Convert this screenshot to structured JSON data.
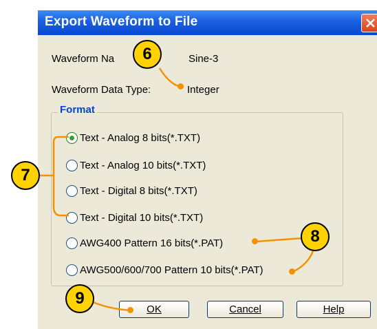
{
  "dialog": {
    "title": "Export Waveform to File",
    "waveform_name_label": "Waveform Na",
    "waveform_name_value": "Sine-3",
    "data_type_label": "Waveform Data Type:",
    "data_type_value": "Integer"
  },
  "format": {
    "legend": "Format",
    "options": [
      {
        "label": "Text - Analog 8 bits(*.TXT)",
        "selected": true
      },
      {
        "label": "Text - Analog 10 bits(*.TXT)",
        "selected": false
      },
      {
        "label": "Text - Digital 8 bits(*.TXT)",
        "selected": false
      },
      {
        "label": "Text - Digital 10 bits(*.TXT)",
        "selected": false
      },
      {
        "label": "AWG400 Pattern 16 bits(*.PAT)",
        "selected": false
      },
      {
        "label": "AWG500/600/700 Pattern 10 bits(*.PAT)",
        "selected": false
      }
    ]
  },
  "buttons": {
    "ok": "OK",
    "cancel": "Cancel",
    "help": "Help"
  },
  "callouts": [
    "6",
    "7",
    "8",
    "9"
  ],
  "colors": {
    "callout_fill": "#ffd200",
    "callout_line": "#f39200",
    "title_bar": "#1a5fe0"
  }
}
